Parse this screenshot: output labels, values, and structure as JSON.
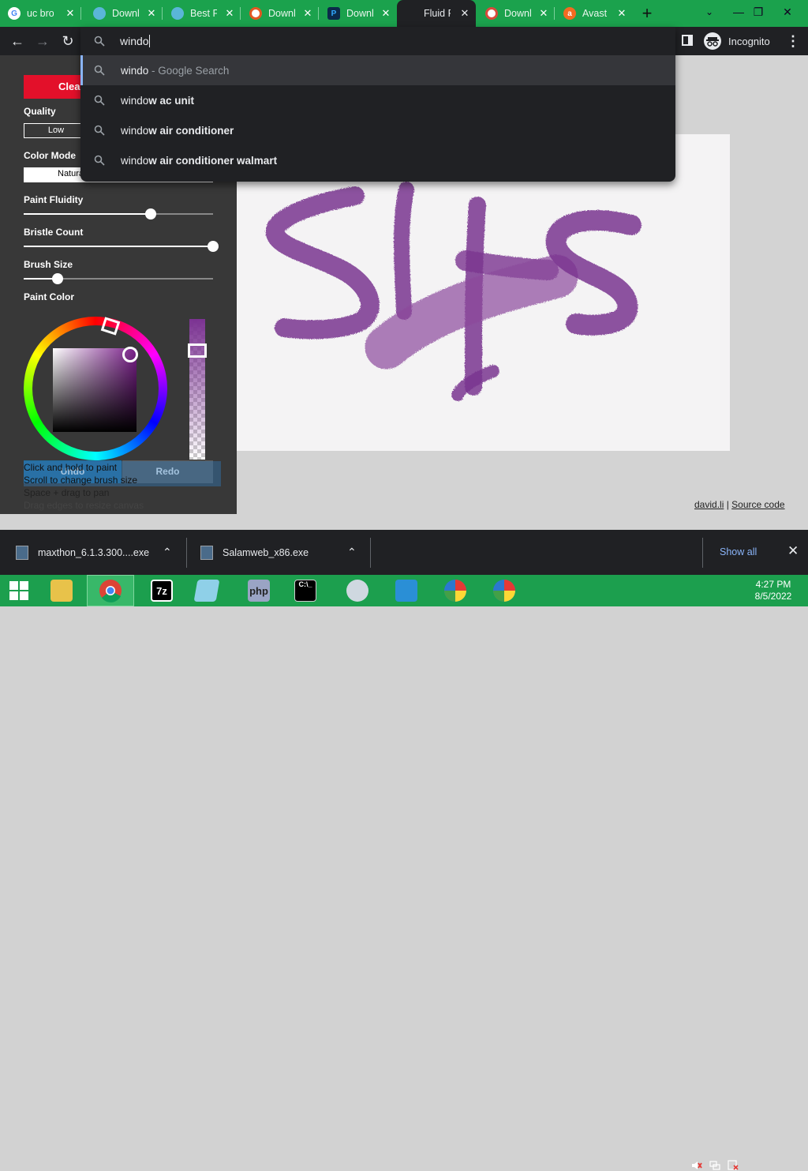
{
  "tabs": [
    {
      "label": "uc bro",
      "icon": "google-icon",
      "active": false
    },
    {
      "label": "Downl",
      "icon": "globe-icon",
      "active": false
    },
    {
      "label": "Best Fr",
      "icon": "globe-icon",
      "active": false
    },
    {
      "label": "Downl",
      "icon": "filehippo-icon",
      "active": false
    },
    {
      "label": "Downl",
      "icon": "photoshop-icon",
      "active": false
    },
    {
      "label": "Fluid P",
      "icon": "none",
      "active": true
    },
    {
      "label": "Downl",
      "icon": "softonic-icon",
      "active": false
    },
    {
      "label": "Avast",
      "icon": "avast-icon",
      "active": false
    }
  ],
  "omnibox": {
    "query": "windo",
    "suggestions": [
      {
        "typed": "windo",
        "rest": "",
        "suffix": " - Google Search",
        "selected": true
      },
      {
        "typed": "windo",
        "rest": "w ac unit",
        "suffix": "",
        "selected": false
      },
      {
        "typed": "windo",
        "rest": "w air conditioner",
        "suffix": "",
        "selected": false
      },
      {
        "typed": "windo",
        "rest": "w air conditioner walmart",
        "suffix": "",
        "selected": false
      }
    ]
  },
  "toolbar": {
    "incognito_label": "Incognito"
  },
  "panel": {
    "clear_label": "Clear",
    "quality_label": "Quality",
    "quality_value": "Low",
    "color_mode_label": "Color Mode",
    "color_mode_value": "Natural",
    "fluidity_label": "Paint Fluidity",
    "fluidity_value": 0.67,
    "bristle_label": "Bristle Count",
    "bristle_value": 1.0,
    "brush_label": "Brush Size",
    "brush_value": 0.18,
    "paint_color_label": "Paint Color",
    "undo_label": "Undo",
    "redo_label": "Redo",
    "help_lines": [
      "Click and hold to paint",
      "Scroll to change brush size",
      "Space + drag to pan",
      "Drag edges to resize canvas"
    ]
  },
  "footer_links": {
    "author": "david.li",
    "separator": "|",
    "source": "Source code"
  },
  "downloads": [
    {
      "filename": "maxthon_6.1.3.300....exe"
    },
    {
      "filename": "Salamweb_x86.exe"
    }
  ],
  "download_bar": {
    "show_all": "Show all"
  },
  "taskbar": {
    "apps": [
      "file-explorer",
      "chrome",
      "7zip",
      "notepad-plus",
      "php",
      "command-prompt",
      "media-player",
      "winrar",
      "maxthon",
      "maxthon-2"
    ],
    "clock_time": "4:27 PM",
    "clock_date": "8/5/2022"
  },
  "colors": {
    "tabstrip": "#1ba24d",
    "chrome_dark": "#202124",
    "clear_button": "#e3102a",
    "paint": "#7b3292",
    "taskbar": "#1c9f4e"
  }
}
